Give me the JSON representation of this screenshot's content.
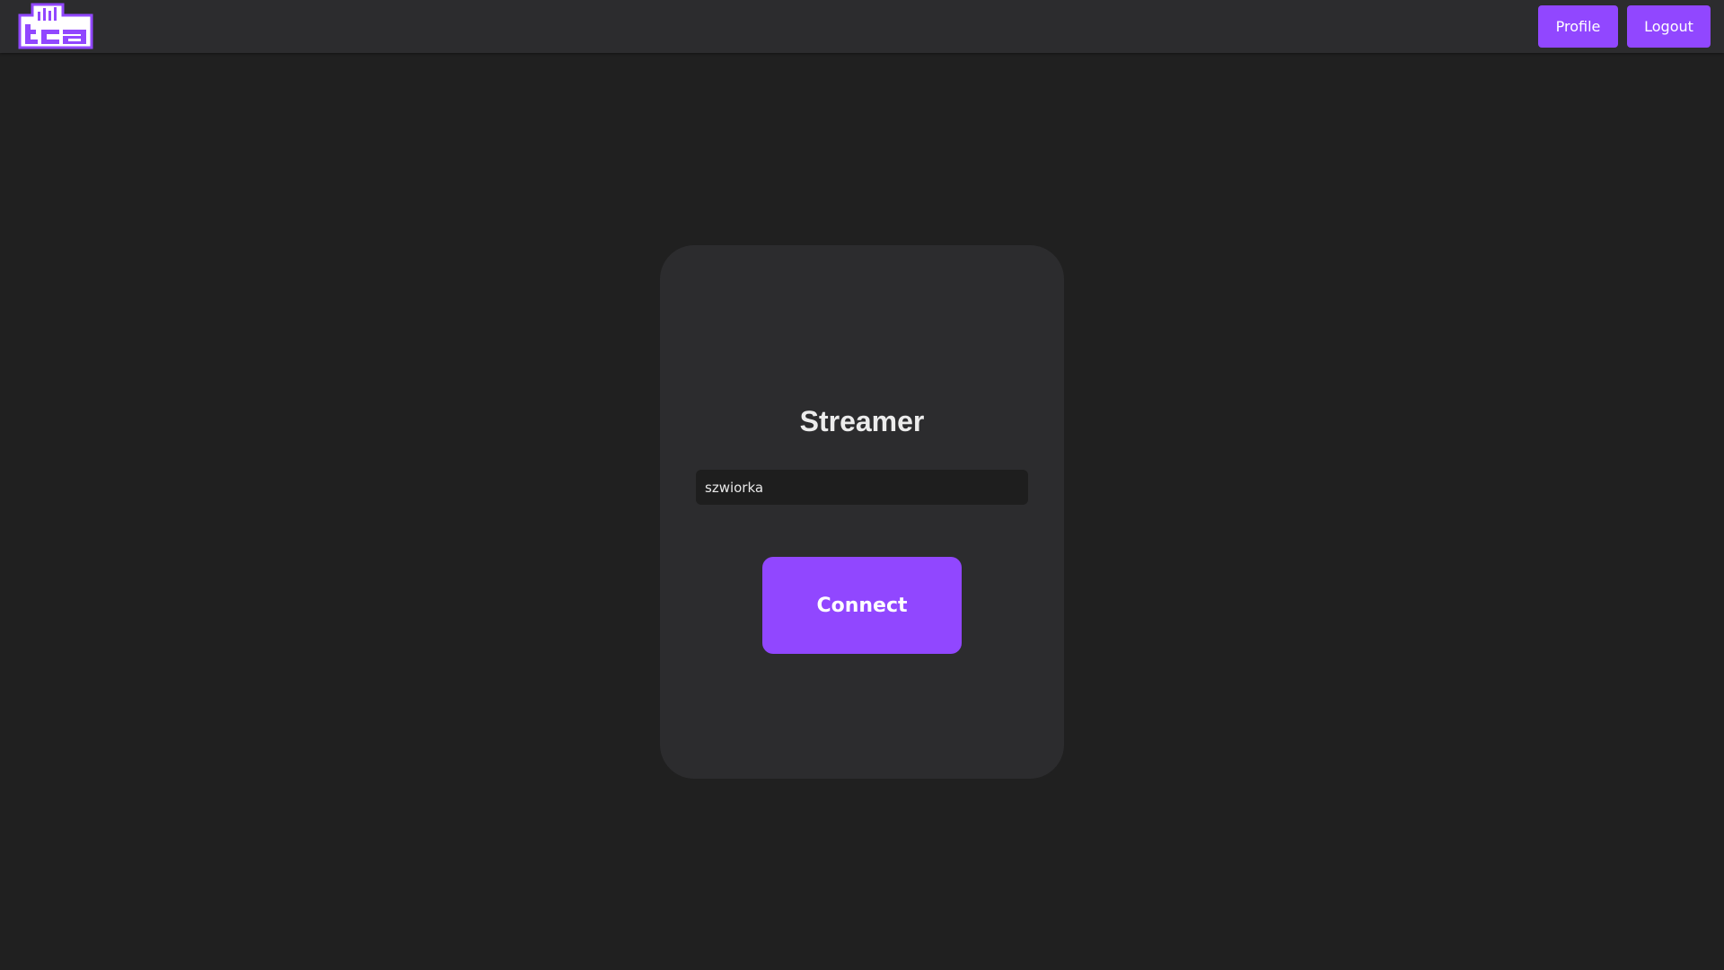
{
  "header": {
    "logo_icon": "tca-logo-icon",
    "profile_label": "Profile",
    "logout_label": "Logout"
  },
  "card": {
    "title": "Streamer",
    "input_value": "szwiorka",
    "connect_label": "Connect"
  },
  "colors": {
    "background": "#202020",
    "surface": "#2c2c2e",
    "input_background": "#1e1e1e",
    "accent": "#9147ff",
    "text": "#ececec"
  }
}
